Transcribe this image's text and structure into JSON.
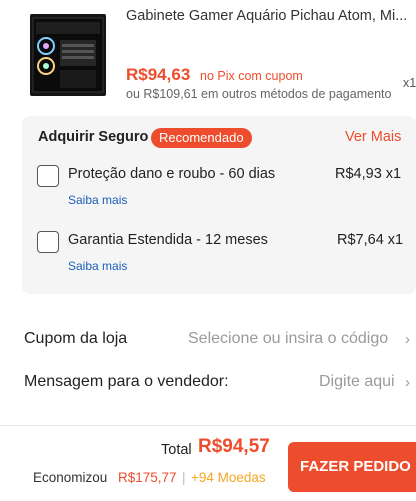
{
  "product": {
    "title": "Gabinete Gamer Aquário Pichau Atom, Mi...",
    "price": "R$94,63",
    "pix_text": "no Pix com cupom",
    "other_price": "ou R$109,61 em outros métodos de pagamento",
    "quantity": "x1"
  },
  "insurance": {
    "title": "Adquirir Seguro",
    "badge": "Recomendado",
    "see_more": "Ver Mais",
    "options": [
      {
        "label": "Proteção dano e roubo - 60 dias",
        "price": "R$4,93 x1",
        "learn_more": "Saiba mais"
      },
      {
        "label": "Garantia Estendida - 12 meses",
        "price": "R$7,64 x1",
        "learn_more": "Saiba mais"
      }
    ]
  },
  "store_coupon": {
    "label": "Cupom da loja",
    "value": "Selecione ou insira o código"
  },
  "seller_message": {
    "label": "Mensagem para o vendedor:",
    "placeholder": "Digite aqui"
  },
  "footer": {
    "total_label": "Total",
    "total_value": "R$94,57",
    "savings_label": "Economizou",
    "savings_value": "R$175,77",
    "separator": "|",
    "coins": "+94 Moedas",
    "order_button": "FAZER PEDIDO"
  },
  "colors": {
    "accent": "#ee4d2d",
    "link": "#1b5fb8",
    "coins": "#f5a623"
  }
}
